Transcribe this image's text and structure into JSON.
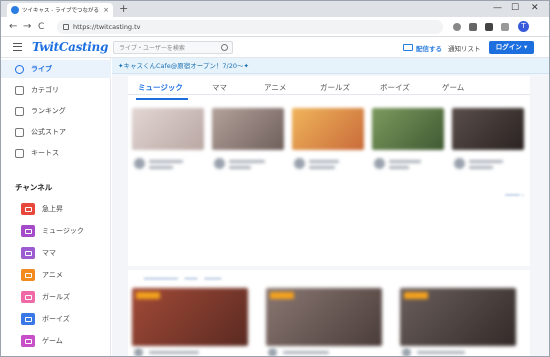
{
  "browser": {
    "tab_title": "ツイキャス - ライブでつながるコミュニ…",
    "tab_close": "×",
    "new_tab": "+",
    "window_controls": [
      "—",
      "☐",
      "✕"
    ],
    "url": "https://twitcasting.tv",
    "nav": {
      "back": "←",
      "forward": "→",
      "reload": "C"
    },
    "profile_initial": "T"
  },
  "header": {
    "logo": "TwitCasting",
    "search_placeholder": "ライブ・ユーザーを検索",
    "broadcast_label": "配信する",
    "notify_label": "通知リスト",
    "login_label": "ログイン ▾"
  },
  "sidebar": {
    "items": [
      {
        "label": "ライブ",
        "icon": "live-icon",
        "active": true
      },
      {
        "label": "カテゴリ",
        "icon": "list-icon",
        "active": false
      },
      {
        "label": "ランキング",
        "icon": "ranking-icon",
        "active": false
      },
      {
        "label": "公式ストア",
        "icon": "store-icon",
        "active": false
      },
      {
        "label": "キートス",
        "icon": "kiitos-icon",
        "active": false
      }
    ],
    "channel_heading": "チャンネル",
    "channels": [
      {
        "label": "急上昇",
        "color": "#e8473c"
      },
      {
        "label": "ミュージック",
        "color": "#a54bc9"
      },
      {
        "label": "ママ",
        "color": "#9c5bd0"
      },
      {
        "label": "アニメ",
        "color": "#f28a1e"
      },
      {
        "label": "ガールズ",
        "color": "#ef6aa7"
      },
      {
        "label": "ボーイズ",
        "color": "#3a78e6"
      },
      {
        "label": "ゲーム",
        "color": "#c94fc9"
      }
    ]
  },
  "main": {
    "banner": "✦キャスくんCafe@原宿オープン！7/20〜✦",
    "category_tabs": [
      {
        "label": "ミュージック",
        "active": true
      },
      {
        "label": "ママ",
        "active": false
      },
      {
        "label": "アニメ",
        "active": false
      },
      {
        "label": "ガールズ",
        "active": false
      },
      {
        "label": "ボーイズ",
        "active": false
      },
      {
        "label": "ゲーム",
        "active": false
      }
    ],
    "thumb_colors": [
      "#d7c9c6",
      "#9c8a85",
      "#e4a24a",
      "#5b7a4a",
      "#3a3331"
    ],
    "rec_colors": [
      "#8b3b2e",
      "#6e5a56",
      "#4e4442"
    ]
  }
}
